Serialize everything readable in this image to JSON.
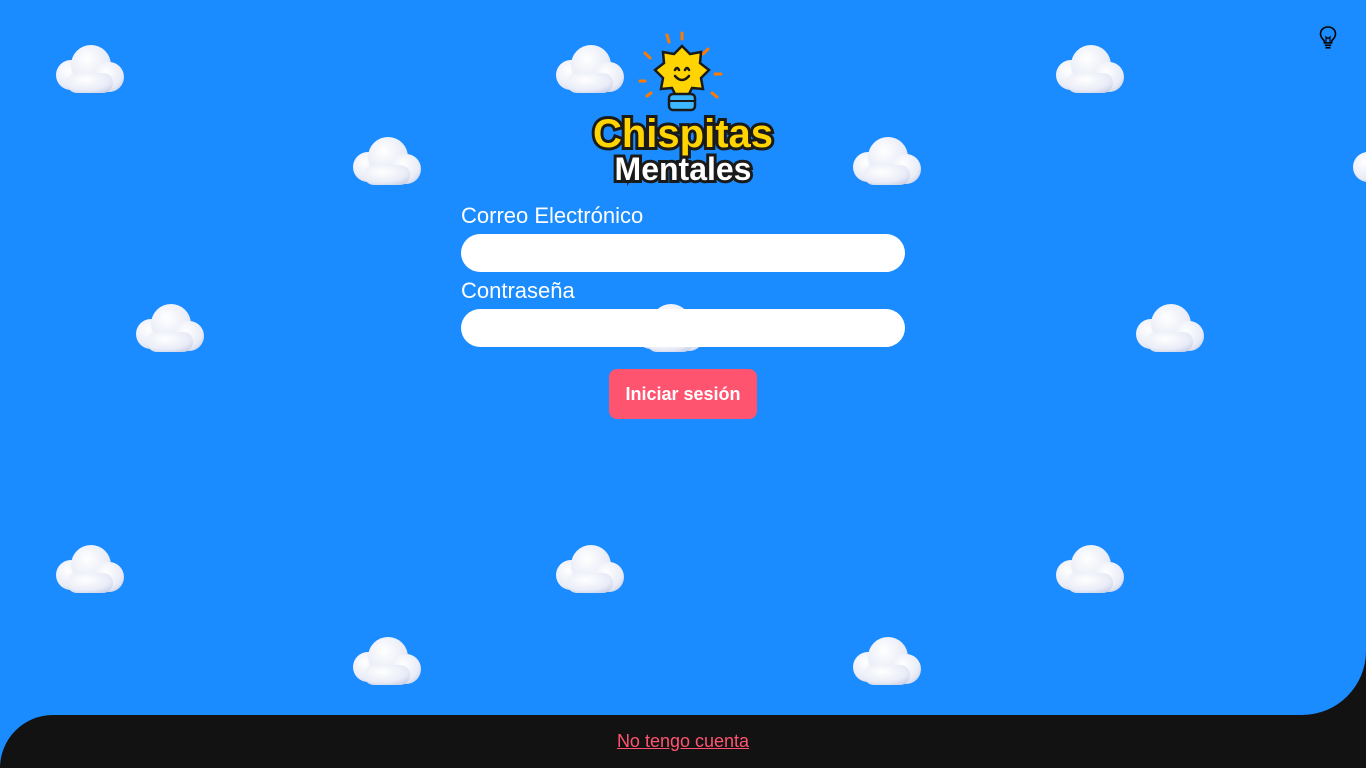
{
  "app": {
    "logo_line1": "Chispitas",
    "logo_line2": "Mentales"
  },
  "form": {
    "email_label": "Correo Electrónico",
    "email_value": "",
    "password_label": "Contraseña",
    "password_value": "",
    "submit_label": "Iniciar sesión"
  },
  "footer": {
    "link_label": "No tengo cuenta"
  },
  "icons": {
    "hint": "lightbulb-icon",
    "clouds": "cloud-icon"
  },
  "colors": {
    "background": "#1a8cff",
    "accent": "#ff5470",
    "footer": "#121212",
    "logo_yellow": "#ffd400"
  }
}
